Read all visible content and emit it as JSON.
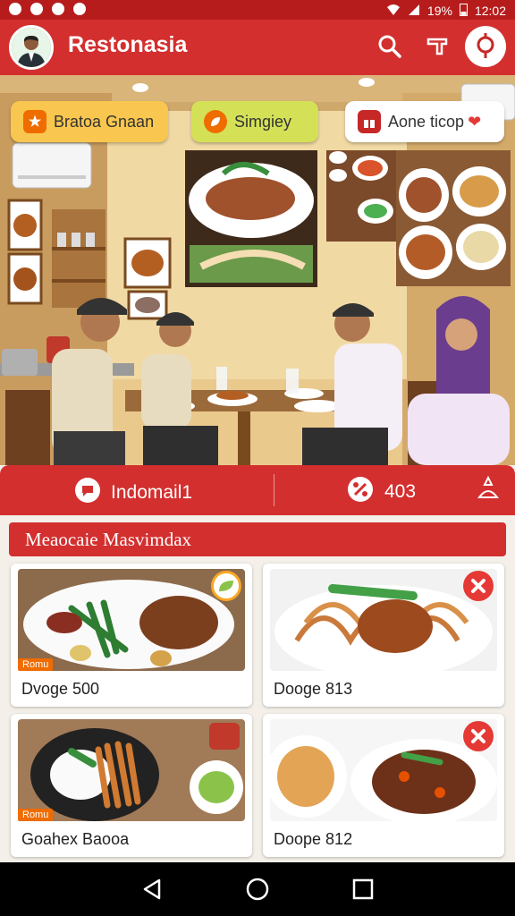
{
  "status": {
    "battery": "19%",
    "time": "12:02"
  },
  "app": {
    "title": "Restonasia"
  },
  "chips": [
    {
      "label": "Bratoa Gnaan",
      "icon": "star-badge-icon",
      "color": "#f9c74f"
    },
    {
      "label": "Simgiey",
      "icon": "leaf-icon",
      "color": "#d4e157"
    },
    {
      "label": "Aone ticop",
      "icon": "gift-box-icon",
      "color": "#ffffff"
    }
  ],
  "infobar": {
    "left_label": "Indomail1",
    "middle_label": "403"
  },
  "section": {
    "title": "Meaocaie Masvimdax"
  },
  "cards": [
    {
      "label": "Dvoge 500",
      "tag": "Romu"
    },
    {
      "label": "Dooge 813",
      "tag": ""
    },
    {
      "label": "Goahex Baooa",
      "tag": "Romu"
    },
    {
      "label": "Doope 812",
      "tag": ""
    }
  ],
  "colors": {
    "primary": "#d32f2f",
    "primary_dark": "#b71c1c",
    "accent": "#ef6c00"
  }
}
